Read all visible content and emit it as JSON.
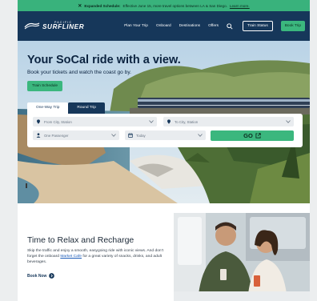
{
  "alert": {
    "title": "Expanded Schedule:",
    "text": "Effective June 15, more travel options between LA & San Diego.",
    "link": "Learn more."
  },
  "header": {
    "logo_small": "PACIFIC",
    "logo_big": "SURFLINER",
    "nav": [
      "Plan Your Trip",
      "Onboard",
      "Destinations",
      "Offers"
    ],
    "train_status": "Train Status",
    "book_trip": "Book Trip"
  },
  "hero": {
    "title": "Your SoCal ride with a view.",
    "subtitle": "Book your tickets and watch the coast go by.",
    "schedule_btn": "Train Schedule"
  },
  "booking": {
    "tabs": [
      "One-Way Trip",
      "Round Trip"
    ],
    "from_placeholder": "From City, Station",
    "to_placeholder": "To City, Station",
    "passengers": "One Passenger",
    "date": "Today",
    "go": "GO"
  },
  "lower": {
    "title": "Time to Relax and Recharge",
    "text_before": "Skip the traffic and enjoy a smooth, easygoing ride with iconic views. And don't forget the onboard ",
    "link": "Market Cafe",
    "text_after": " for a great variety of snacks, drinks, and adult beverages.",
    "book_now": "Book Now"
  },
  "colors": {
    "navy": "#16375a",
    "green": "#3bb77e",
    "alert": "#39b27c"
  },
  "icons": [
    "close-icon",
    "search-icon",
    "location-pin-icon",
    "person-icon",
    "calendar-icon",
    "chevron-down-icon",
    "external-link-icon",
    "arrow-circle-icon"
  ]
}
